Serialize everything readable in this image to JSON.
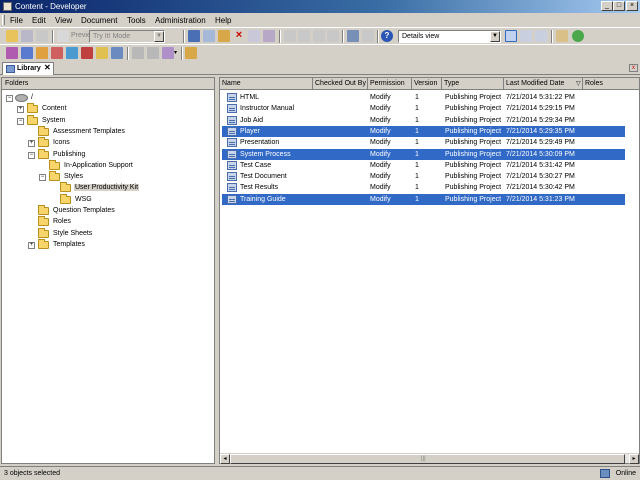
{
  "window": {
    "title": "Content - Developer"
  },
  "menu": [
    "File",
    "Edit",
    "View",
    "Document",
    "Tools",
    "Administration",
    "Help"
  ],
  "toolbar": {
    "preview_label": "Preview",
    "mode_combo_value": "Try It! Mode",
    "view_combo_value": "Details view"
  },
  "tab": {
    "label": "Library",
    "close": "✕"
  },
  "folders": {
    "header": "Folders",
    "tree": [
      {
        "label": "/",
        "level": 0,
        "expander": "-"
      },
      {
        "label": "Content",
        "level": 1,
        "expander": "+"
      },
      {
        "label": "System",
        "level": 1,
        "expander": "-"
      },
      {
        "label": "Assessment Templates",
        "level": 2,
        "expander": ""
      },
      {
        "label": "Icons",
        "level": 2,
        "expander": "+"
      },
      {
        "label": "Publishing",
        "level": 2,
        "expander": "-"
      },
      {
        "label": "In-Application Support",
        "level": 3,
        "expander": ""
      },
      {
        "label": "Styles",
        "level": 3,
        "expander": "-"
      },
      {
        "label": "User Productivity Kit",
        "level": 4,
        "expander": "",
        "selected": true
      },
      {
        "label": "WSG",
        "level": 4,
        "expander": ""
      },
      {
        "label": "Question Templates",
        "level": 2,
        "expander": ""
      },
      {
        "label": "Roles",
        "level": 2,
        "expander": ""
      },
      {
        "label": "Style Sheets",
        "level": 2,
        "expander": ""
      },
      {
        "label": "Templates",
        "level": 2,
        "expander": "+"
      }
    ]
  },
  "table": {
    "columns": [
      "Name",
      "Checked Out By",
      "Permission",
      "Version",
      "Type",
      "Last Modified Date",
      "Roles"
    ],
    "sort_indicator": "▽",
    "rows": [
      {
        "name": "HTML",
        "checked_out_by": "",
        "permission": "Modify",
        "version": "1",
        "type": "Publishing Project",
        "modified": "7/21/2014 5:31:22 PM",
        "selected": false
      },
      {
        "name": "Instructor Manual",
        "checked_out_by": "",
        "permission": "Modify",
        "version": "1",
        "type": "Publishing Project",
        "modified": "7/21/2014 5:29:15 PM",
        "selected": false
      },
      {
        "name": "Job Aid",
        "checked_out_by": "",
        "permission": "Modify",
        "version": "1",
        "type": "Publishing Project",
        "modified": "7/21/2014 5:29:34 PM",
        "selected": false
      },
      {
        "name": "Player",
        "checked_out_by": "",
        "permission": "Modify",
        "version": "1",
        "type": "Publishing Project",
        "modified": "7/21/2014 5:29:35 PM",
        "selected": true
      },
      {
        "name": "Presentation",
        "checked_out_by": "",
        "permission": "Modify",
        "version": "1",
        "type": "Publishing Project",
        "modified": "7/21/2014 5:29:49 PM",
        "selected": false
      },
      {
        "name": "System Process",
        "checked_out_by": "",
        "permission": "Modify",
        "version": "1",
        "type": "Publishing Project",
        "modified": "7/21/2014 5:30:09 PM",
        "selected": true
      },
      {
        "name": "Test Case",
        "checked_out_by": "",
        "permission": "Modify",
        "version": "1",
        "type": "Publishing Project",
        "modified": "7/21/2014 5:31:42 PM",
        "selected": false
      },
      {
        "name": "Test Document",
        "checked_out_by": "",
        "permission": "Modify",
        "version": "1",
        "type": "Publishing Project",
        "modified": "7/21/2014 5:30:27 PM",
        "selected": false
      },
      {
        "name": "Test Results",
        "checked_out_by": "",
        "permission": "Modify",
        "version": "1",
        "type": "Publishing Project",
        "modified": "7/21/2014 5:30:42 PM",
        "selected": false
      },
      {
        "name": "Training Guide",
        "checked_out_by": "",
        "permission": "Modify",
        "version": "1",
        "type": "Publishing Project",
        "modified": "7/21/2014 5:31:23 PM",
        "selected": true
      }
    ]
  },
  "status": {
    "left": "3 objects selected",
    "right": "Online"
  },
  "colors": {
    "selection": "#3169c6",
    "chrome": "#d4d0c8",
    "title_start": "#0a246a"
  }
}
